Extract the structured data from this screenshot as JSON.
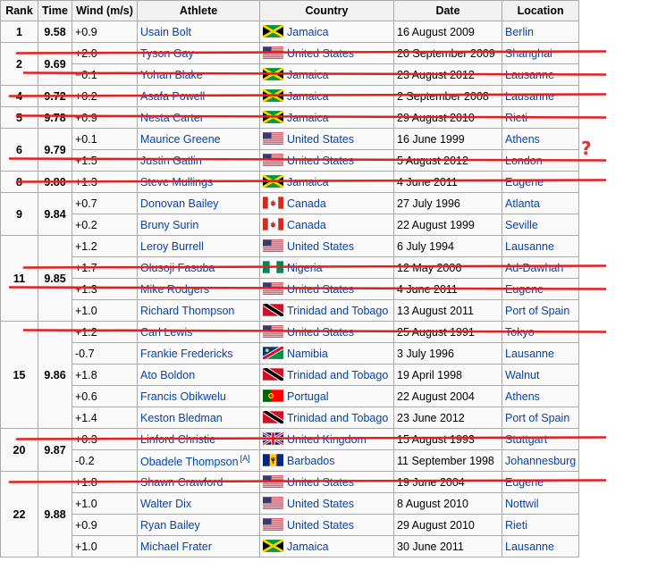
{
  "headers": [
    "Rank",
    "Time",
    "Wind (m/s)",
    "Athlete",
    "Country",
    "Date",
    "Location"
  ],
  "rows": [
    {
      "rank": "1",
      "time": "9.58",
      "wind": "+0.9",
      "athlete": "Usain Bolt",
      "country": "Jamaica",
      "flag": "jamaica-flag",
      "date": "16 August 2009",
      "location": "Berlin",
      "struck": false
    },
    {
      "rank": "2",
      "time": "9.69",
      "wind": "+2.0",
      "athlete": "Tyson Gay",
      "country": "United States",
      "flag": "usa-flag",
      "date": "20 September 2009",
      "location": "Shanghai",
      "struck": true
    },
    {
      "wind": "−0.1",
      "athlete": "Yohan Blake",
      "country": "Jamaica",
      "flag": "jamaica-flag",
      "date": "23 August 2012",
      "location": "Lausanne",
      "struck": true
    },
    {
      "rank": "4",
      "time": "9.72",
      "wind": "+0.2",
      "athlete": "Asafa Powell",
      "country": "Jamaica",
      "flag": "jamaica-flag",
      "date": "2 September 2008",
      "location": "Lausanne",
      "struck": true
    },
    {
      "rank": "5",
      "time": "9.78",
      "wind": "+0.9",
      "athlete": "Nesta Carter",
      "country": "Jamaica",
      "flag": "jamaica-flag",
      "date": "29 August 2010",
      "location": "Rieti",
      "struck": true
    },
    {
      "rank": "6",
      "time": "9.79",
      "wind": "+0.1",
      "athlete": "Maurice Greene",
      "country": "United States",
      "flag": "usa-flag",
      "date": "16 June 1999",
      "location": "Athens",
      "struck": false
    },
    {
      "wind": "+1.5",
      "athlete": "Justin Gatlin",
      "country": "United States",
      "flag": "usa-flag",
      "date": "5 August 2012",
      "location": "London",
      "struck": true
    },
    {
      "rank": "8",
      "time": "9.80",
      "wind": "+1.3",
      "athlete": "Steve Mullings",
      "country": "Jamaica",
      "flag": "jamaica-flag",
      "date": "4 June 2011",
      "location": "Eugene",
      "struck": true
    },
    {
      "rank": "9",
      "time": "9.84",
      "wind": "+0.7",
      "athlete": "Donovan Bailey",
      "country": "Canada",
      "flag": "canada-flag",
      "date": "27 July 1996",
      "location": "Atlanta",
      "struck": false
    },
    {
      "wind": "+0.2",
      "athlete": "Bruny Surin",
      "country": "Canada",
      "flag": "canada-flag",
      "date": "22 August 1999",
      "location": "Seville",
      "struck": false
    },
    {
      "rank": "11",
      "time": "9.85",
      "wind": "+1.2",
      "athlete": "Leroy Burrell",
      "country": "United States",
      "flag": "usa-flag",
      "date": "6 July 1994",
      "location": "Lausanne",
      "struck": false
    },
    {
      "wind": "+1.7",
      "athlete": "Olusoji Fasuba",
      "country": "Nigeria",
      "flag": "nigeria-flag",
      "date": "12 May 2006",
      "location": "Ad-Dawhah",
      "struck": true
    },
    {
      "wind": "+1.3",
      "athlete": "Mike Rodgers",
      "country": "United States",
      "flag": "usa-flag",
      "date": "4 June 2011",
      "location": "Eugene",
      "struck": true
    },
    {
      "wind": "+1.0",
      "athlete": "Richard Thompson",
      "country": "Trinidad and Tobago",
      "flag": "trinidad-flag",
      "date": "13 August 2011",
      "location": "Port of Spain",
      "struck": false
    },
    {
      "rank": "15",
      "time": "9.86",
      "wind": "+1.2",
      "athlete": "Carl Lewis",
      "country": "United States",
      "flag": "usa-flag",
      "date": "25 August 1991",
      "location": "Tokyo",
      "struck": true
    },
    {
      "wind": "-0.7",
      "athlete": "Frankie Fredericks",
      "country": "Namibia",
      "flag": "namibia-flag",
      "date": "3 July 1996",
      "location": "Lausanne",
      "struck": false
    },
    {
      "wind": "+1.8",
      "athlete": "Ato Boldon",
      "country": "Trinidad and Tobago",
      "flag": "trinidad-flag",
      "date": "19 April 1998",
      "location": "Walnut",
      "struck": false
    },
    {
      "wind": "+0.6",
      "athlete": "Francis Obikwelu",
      "country": "Portugal",
      "flag": "portugal-flag",
      "date": "22 August 2004",
      "location": "Athens",
      "struck": false
    },
    {
      "wind": "+1.4",
      "athlete": "Keston Bledman",
      "country": "Trinidad and Tobago",
      "flag": "trinidad-flag",
      "date": "23 June 2012",
      "location": "Port of Spain",
      "struck": false
    },
    {
      "rank": "20",
      "time": "9.87",
      "wind": "+0.3",
      "athlete": "Linford Christie",
      "country": "United Kingdom",
      "flag": "uk-flag",
      "date": "15 August 1993",
      "location": "Stuttgart",
      "struck": true
    },
    {
      "wind": "-0.2",
      "athlete": "Obadele Thompson",
      "note": "[A]",
      "country": "Barbados",
      "flag": "barbados-flag",
      "date": "11 September 1998",
      "location": "Johannesburg",
      "struck": false
    },
    {
      "rank": "22",
      "time": "9.88",
      "wind": "+1.8",
      "athlete": "Shawn Crawford",
      "country": "United States",
      "flag": "usa-flag",
      "date": "19 June 2004",
      "location": "Eugene",
      "struck": true
    },
    {
      "wind": "+1.0",
      "athlete": "Walter Dix",
      "country": "United States",
      "flag": "usa-flag",
      "date": "8 August 2010",
      "location": "Nottwil",
      "struck": false
    },
    {
      "wind": "+0.9",
      "athlete": "Ryan Bailey",
      "country": "United States",
      "flag": "usa-flag",
      "date": "29 August 2010",
      "location": "Rieti",
      "struck": false
    },
    {
      "wind": "+1.0",
      "athlete": "Michael Frater",
      "country": "Jamaica",
      "flag": "jamaica-flag",
      "date": "30 June 2011",
      "location": "Lausanne",
      "struck": false
    }
  ],
  "groups": [
    {
      "start": 1,
      "span": 2
    },
    {
      "start": 5,
      "span": 2
    },
    {
      "start": 8,
      "span": 2
    },
    {
      "start": 10,
      "span": 4
    },
    {
      "start": 14,
      "span": 5
    },
    {
      "start": 19,
      "span": 2
    },
    {
      "start": 21,
      "span": 4
    }
  ],
  "annotation": {
    "question_mark": "?",
    "strike_color": "#dd2222",
    "question_color": "#e03030"
  }
}
